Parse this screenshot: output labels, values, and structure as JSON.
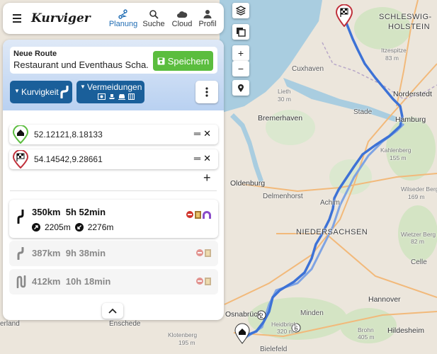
{
  "app": {
    "logo": "Kurviger",
    "nav": [
      {
        "label": "Planung",
        "icon": "route-icon",
        "active": true
      },
      {
        "label": "Suche",
        "icon": "search-icon",
        "active": false
      },
      {
        "label": "Cloud",
        "icon": "cloud-icon",
        "active": false
      },
      {
        "label": "Profil",
        "icon": "user-icon",
        "active": false
      }
    ]
  },
  "route": {
    "label": "Neue Route",
    "name": "Restaurant und Eventhaus Scha...",
    "save_label": "Speichern",
    "curviness_label": "Kurvigkeit",
    "avoid_label": "Vermeidungen"
  },
  "waypoints": [
    {
      "value": "52.12121,8.18133",
      "type": "start"
    },
    {
      "value": "54.14542,9.28661",
      "type": "destination"
    }
  ],
  "routes": [
    {
      "distance": "350km",
      "duration": "5h 52min",
      "ascent": "2205m",
      "descent": "2276m"
    },
    {
      "distance": "387km",
      "duration": "9h 38min"
    },
    {
      "distance": "412km",
      "duration": "10h 18min"
    }
  ],
  "map": {
    "labels": [
      "SCHLESWIG-",
      "HOLSTEIN",
      "Itzespitze",
      "83 m",
      "Cuxhaven",
      "Norderstedt",
      "Hamburg",
      "Stade",
      "Bremerhaven",
      "Oldenburg",
      "Delmenhorst",
      "Achim",
      "NIEDERSACHSEN",
      "Celle",
      "Hannover",
      "Minden",
      "Osnabrück",
      "Enschede",
      "Bielefeld",
      "Hildesheim",
      "Wilseder Berg",
      "169 m",
      "Wietzer Berg",
      "82 m",
      "Kahlenberg",
      "155 m",
      "Klotenberg",
      "195 m",
      "Heidbrink",
      "320 m",
      "Brohn",
      "405 m",
      "Lieth",
      "30 m",
      "Hohe Lieth",
      "erland"
    ],
    "zoom_in": "+",
    "zoom_out": "−",
    "route_color": "#3d72d6",
    "alt_route_color": "#6b98e0"
  }
}
